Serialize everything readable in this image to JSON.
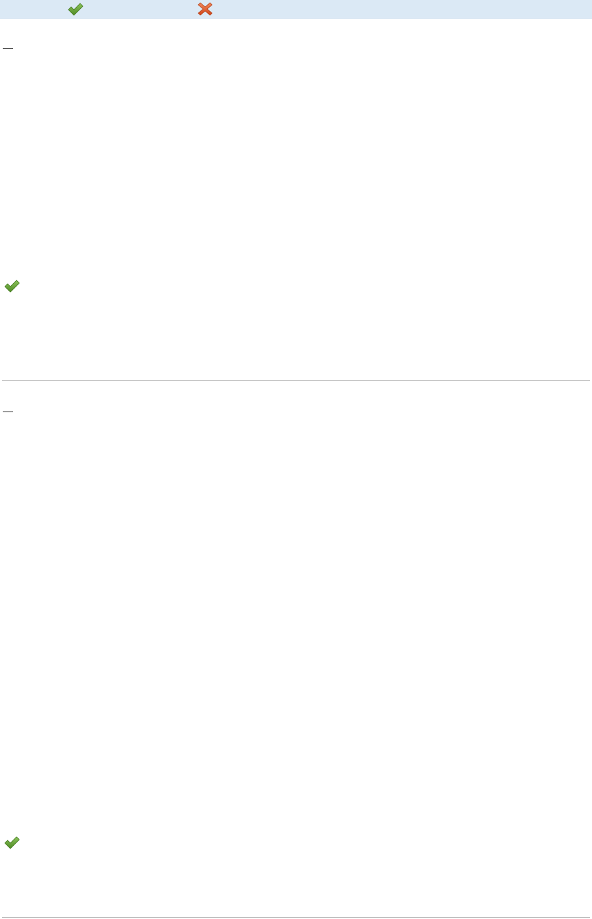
{
  "toolbar": {
    "accept_icon": "check-icon",
    "reject_icon": "close-icon",
    "colors": {
      "background": "#dbe9f5",
      "check": "#6aa13b",
      "cross": "#e05a2b"
    }
  },
  "records": [
    {
      "marker_label": "",
      "status_icon": "check-icon"
    },
    {
      "marker_label": "",
      "status_icon": "check-icon"
    }
  ],
  "colors": {
    "separator": "#a9a9a9"
  }
}
